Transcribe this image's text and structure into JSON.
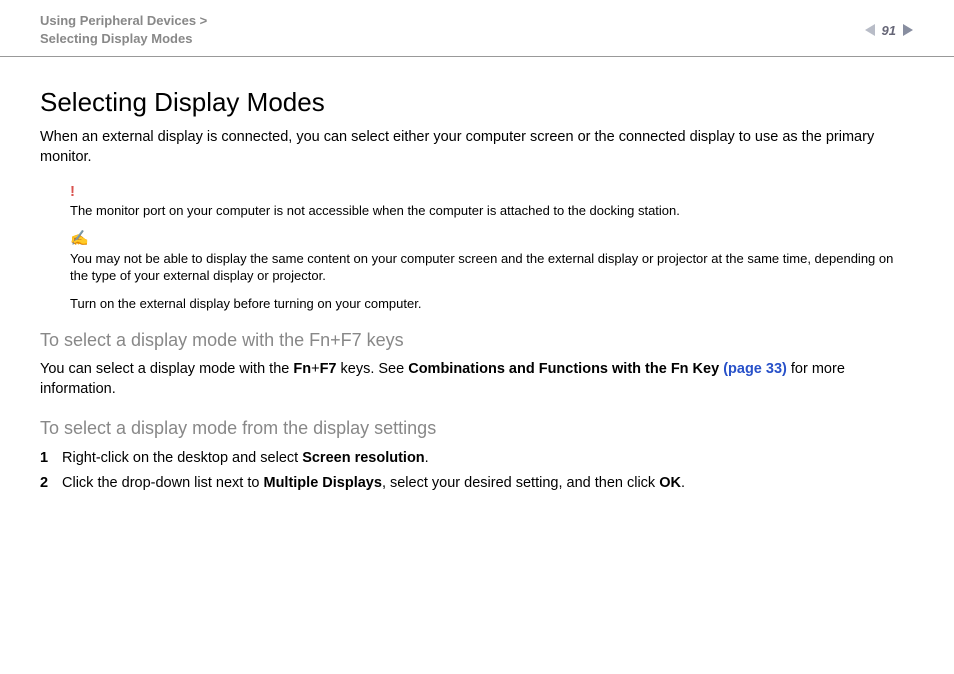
{
  "header": {
    "breadcrumb_line1": "Using Peripheral Devices >",
    "breadcrumb_line2": "Selecting Display Modes",
    "page_number": "91"
  },
  "content": {
    "title": "Selecting Display Modes",
    "intro": "When an external display is connected, you can select either your computer screen or the connected display to use as the primary monitor.",
    "warning_note": "The monitor port on your computer is not accessible when the computer is attached to the docking station.",
    "info_note_p1": "You may not be able to display the same content on your computer screen and the external display or projector at the same time, depending on the type of your external display or projector.",
    "info_note_p2": "Turn on the external display before turning on your computer.",
    "section1_heading": "To select a display mode with the Fn+F7 keys",
    "section1_body_pre": "You can select a display mode with the ",
    "section1_bold1": "Fn",
    "section1_plus": "+",
    "section1_bold2": "F7",
    "section1_body_mid": " keys. See ",
    "section1_bold3": "Combinations and Functions with the Fn Key ",
    "section1_link": "(page 33)",
    "section1_body_post": " for more information.",
    "section2_heading": "To select a display mode from the display settings",
    "step1_pre": "Right-click on the desktop and select ",
    "step1_bold": "Screen resolution",
    "step1_post": ".",
    "step2_pre": "Click the drop-down list next to ",
    "step2_bold1": "Multiple Displays",
    "step2_mid": ", select your desired setting, and then click ",
    "step2_bold2": "OK",
    "step2_post": "."
  }
}
